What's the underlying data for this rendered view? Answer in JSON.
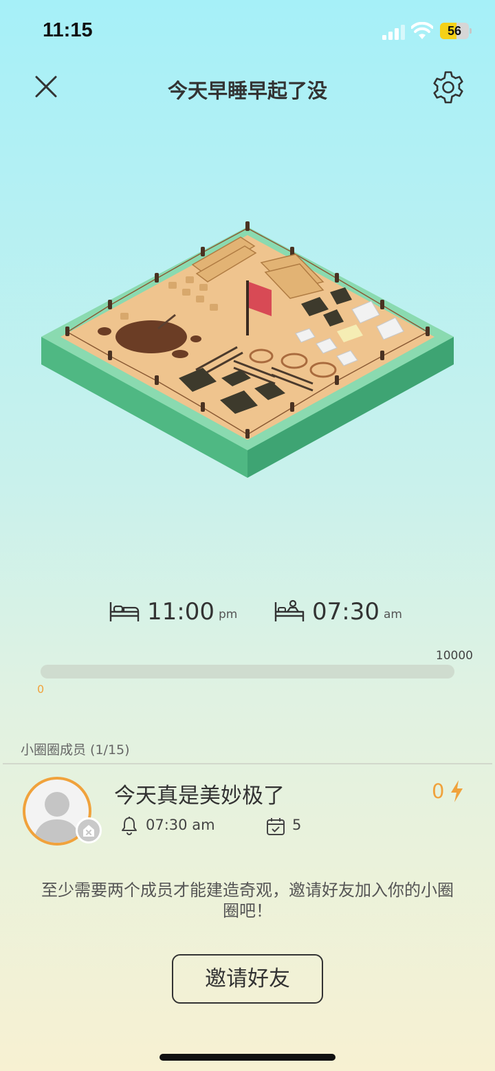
{
  "status_bar": {
    "time": "11:15",
    "battery_level": "56",
    "battery_fraction": 0.56,
    "icons": [
      "cellular-signal-icon",
      "wifi-icon",
      "battery-icon"
    ]
  },
  "header": {
    "title": "今天早睡早起了没",
    "icons": [
      "close-icon",
      "gear-icon"
    ]
  },
  "scene": {
    "description_icon": "construction-site-illustration"
  },
  "schedule": {
    "bedtime": {
      "value": "11:00",
      "suffix": "pm",
      "icon": "bed-icon"
    },
    "wakeup": {
      "value": "07:30",
      "suffix": "am",
      "icon": "wake-up-bed-icon"
    }
  },
  "progress": {
    "min_label": "0",
    "max_label": "10000",
    "current_fraction": 0
  },
  "members": {
    "label": "小圈圈成员 (1/15)",
    "items": [
      {
        "name": "今天真是美妙极了",
        "score": "0",
        "alarm_time": "07:30 am",
        "checkin_days": "5",
        "icons": [
          "avatar-placeholder-icon",
          "home-badge-icon",
          "lightning-icon",
          "bell-icon",
          "calendar-check-icon"
        ]
      }
    ]
  },
  "notice": "至少需要两个成员才能建造奇观，邀请好友加入你的小圈圈吧！",
  "invite_button": "邀请好友",
  "colors": {
    "accent": "#f0a23c",
    "text": "#333333",
    "bg_top": "#a6f0f8",
    "bg_bottom": "#f7f1d2"
  }
}
